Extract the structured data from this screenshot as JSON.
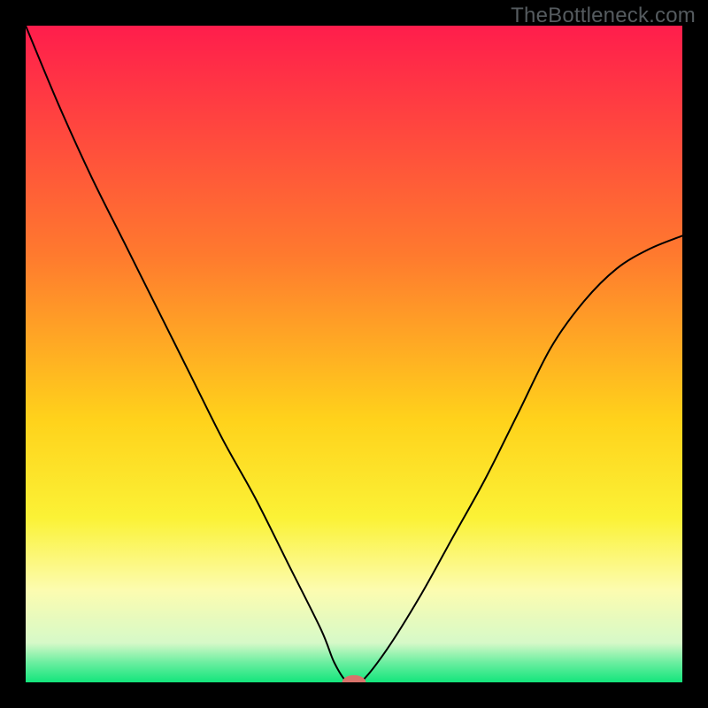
{
  "watermark": "TheBottleneck.com",
  "chart_data": {
    "type": "line",
    "title": "",
    "xlabel": "",
    "ylabel": "",
    "xlim": [
      0,
      100
    ],
    "ylim": [
      0,
      100
    ],
    "background": {
      "gradient_axis": "y",
      "stops": [
        {
          "pos": 0,
          "color": "#ff1d4c"
        },
        {
          "pos": 35,
          "color": "#ff7a2e"
        },
        {
          "pos": 60,
          "color": "#ffd21b"
        },
        {
          "pos": 75,
          "color": "#fbf236"
        },
        {
          "pos": 86,
          "color": "#fcfcb0"
        },
        {
          "pos": 94,
          "color": "#d6f9c8"
        },
        {
          "pos": 97,
          "color": "#6beea0"
        },
        {
          "pos": 100,
          "color": "#13e57c"
        }
      ]
    },
    "series": [
      {
        "name": "curve",
        "x": [
          0,
          5,
          10,
          15,
          20,
          25,
          30,
          35,
          40,
          45,
          47,
          49,
          51,
          55,
          60,
          65,
          70,
          75,
          80,
          85,
          90,
          95,
          100
        ],
        "y": [
          100,
          88,
          77,
          67,
          57,
          47,
          37,
          28,
          18,
          8,
          3,
          0,
          0,
          5,
          13,
          22,
          31,
          41,
          51,
          58,
          63,
          66,
          68
        ],
        "color": "#000000",
        "width": 2
      }
    ],
    "marker": {
      "x": 50,
      "y": 0,
      "rx": 1.8,
      "ry": 1.1,
      "color": "#d9736b"
    }
  }
}
